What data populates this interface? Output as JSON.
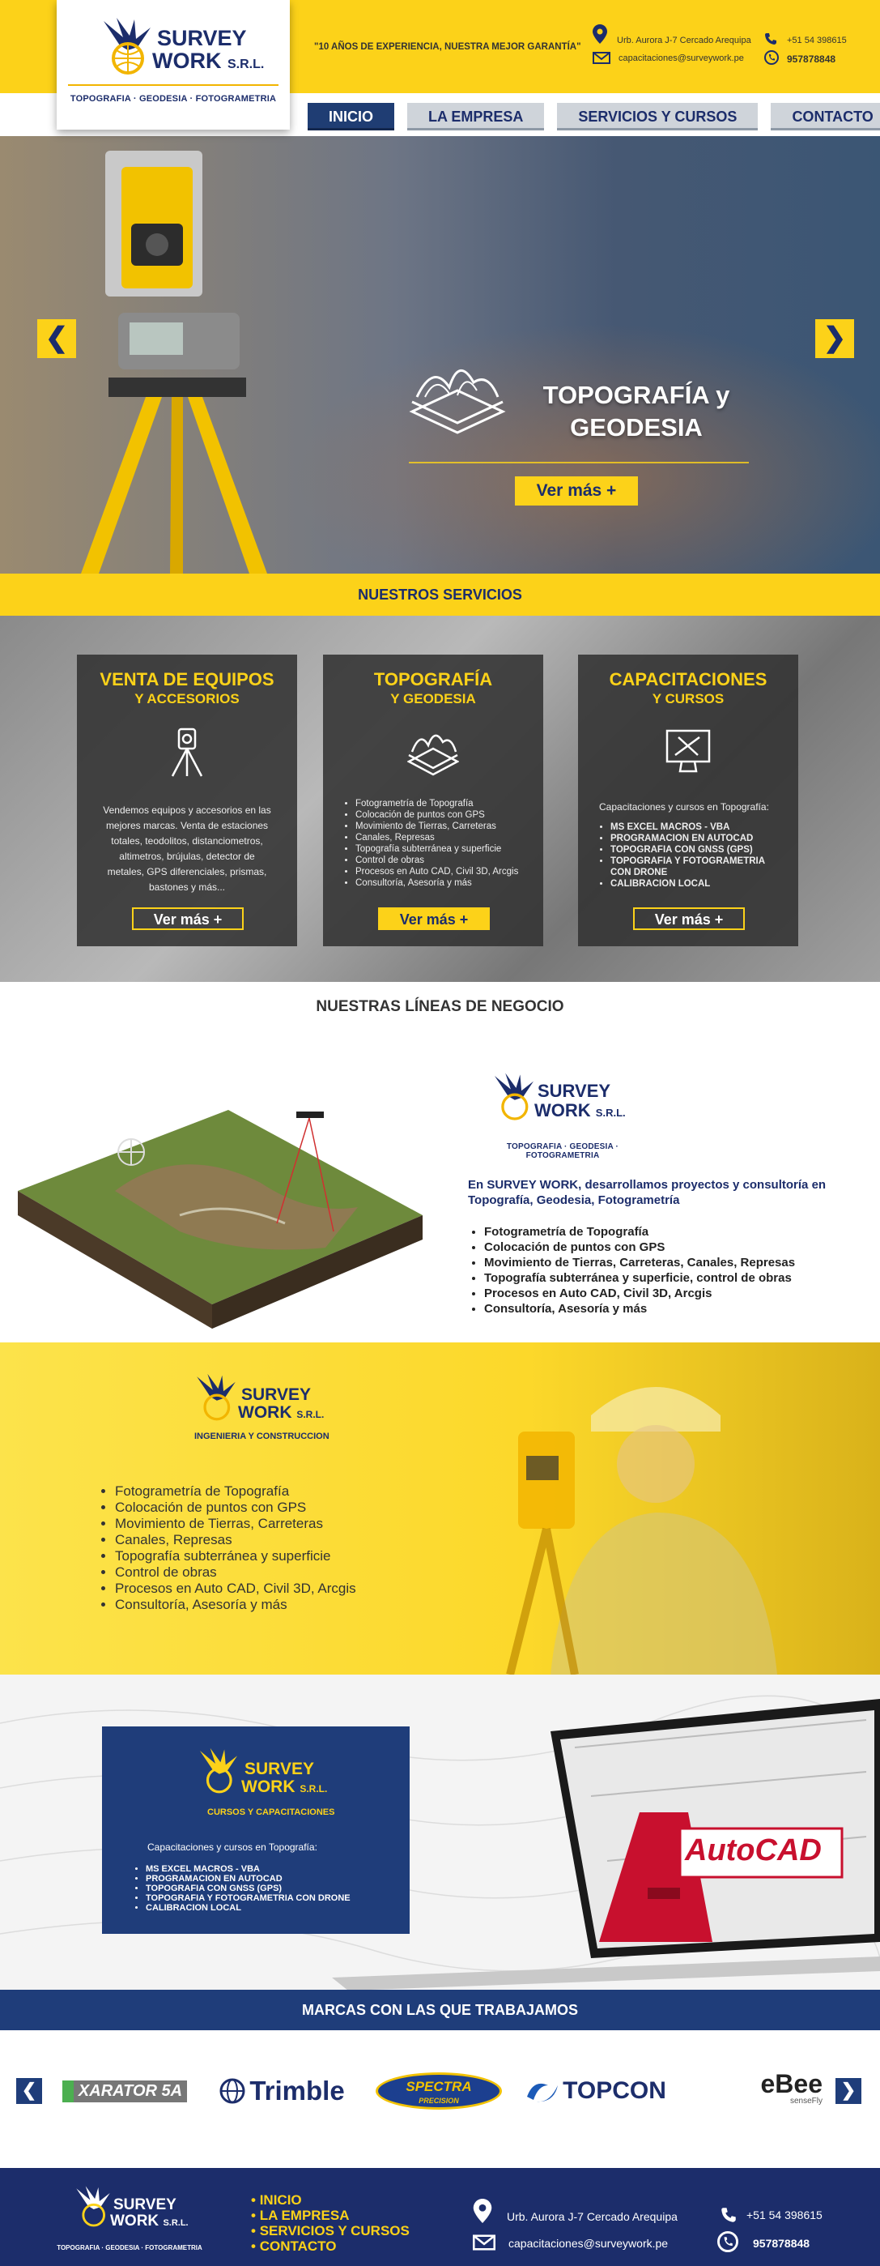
{
  "brand": {
    "name_line1": "SURVEY",
    "name_line2": "WORK",
    "suffix": "S.R.L.",
    "tagline": "TOPOGRAFIA · GEODESIA · FOTOGRAMETRIA",
    "sub_engineering": "INGENIERIA Y CONSTRUCCION",
    "sub_courses": "CURSOS Y CAPACITACIONES"
  },
  "header": {
    "slogan": "\"10 AÑOS DE EXPERIENCIA, NUESTRA MEJOR GARANTÍA\"",
    "address": "Urb. Aurora J-7 Cercado Arequipa",
    "phone": "+51 54 398615",
    "email": "capacitaciones@surveywork.pe",
    "whatsapp": "957878848"
  },
  "nav": {
    "items": [
      {
        "label": "INICIO"
      },
      {
        "label": "LA EMPRESA"
      },
      {
        "label": "SERVICIOS Y CURSOS"
      },
      {
        "label": "CONTACTO"
      }
    ]
  },
  "hero": {
    "title_line1": "TOPOGRAFÍA y",
    "title_line2": "GEODESIA",
    "button": "Ver más +",
    "prev": "❮",
    "next": "❯"
  },
  "services": {
    "heading": "NUESTROS SERVICIOS",
    "cards": [
      {
        "title": "VENTA DE EQUIPOS",
        "subtitle": "Y ACCESORIOS",
        "body": "Vendemos equipos y accesorios en las mejores marcas. Venta de estaciones totales, teodolitos, distanciometros, altimetros, brújulas, detector de metales, GPS diferenciales, prismas, bastones y más...",
        "button": "Ver más +"
      },
      {
        "title": "TOPOGRAFÍA",
        "subtitle": "Y GEODESIA",
        "items": [
          "Fotogrametría de Topografía",
          "Colocación de puntos con GPS",
          "Movimiento de Tierras, Carreteras",
          "Canales, Represas",
          "Topografía subterránea y superficie",
          "Control de obras",
          "Procesos en Auto CAD, Civil 3D, Arcgis",
          "Consultoría, Asesoría y más"
        ],
        "button": "Ver más +"
      },
      {
        "title": "CAPACITACIONES",
        "subtitle": "Y CURSOS",
        "intro": "Capacitaciones y cursos en Topografía:",
        "items": [
          "MS EXCEL MACROS - VBA",
          "PROGRAMACION EN AUTOCAD",
          "TOPOGRAFIA CON GNSS (GPS)",
          "TOPOGRAFIA Y FOTOGRAMETRIA CON DRONE",
          "CALIBRACION LOCAL"
        ],
        "button": "Ver más +"
      }
    ]
  },
  "lines": {
    "heading": "NUESTRAS LÍNEAS DE NEGOCIO",
    "intro": "En SURVEY WORK, desarrollamos proyectos y consultoría en Topografía, Geodesia, Fotogrametría",
    "items": [
      "Fotogrametría de Topografía",
      "Colocación de puntos con GPS",
      "Movimiento de Tierras, Carreteras, Canales, Represas",
      "Topografía subterránea y superficie, control de obras",
      "Procesos en Auto CAD, Civil 3D, Arcgis",
      "Consultoría, Asesoría y más"
    ]
  },
  "engineering": {
    "items": [
      "Fotogrametría de Topografía",
      "Colocación de puntos con GPS",
      "Movimiento de Tierras, Carreteras",
      "Canales, Represas",
      "Topografía subterránea y superficie",
      "Control de obras",
      "Procesos en Auto CAD, Civil 3D, Arcgis",
      "Consultoría, Asesoría y más"
    ]
  },
  "courses": {
    "intro": "Capacitaciones y cursos en Topografía:",
    "items": [
      "MS EXCEL MACROS - VBA",
      "PROGRAMACION EN AUTOCAD",
      "TOPOGRAFIA CON GNSS (GPS)",
      "TOPOGRAFIA Y FOTOGRAMETRIA CON DRONE",
      "CALIBRACION LOCAL"
    ],
    "autocad_label": "AutoCAD"
  },
  "brands": {
    "heading": "MARCAS CON LAS QUE TRABAJAMOS",
    "prev": "❮",
    "next": "❯",
    "items": [
      {
        "label": "XARATOR 5A"
      },
      {
        "label": "Trimble"
      },
      {
        "label": "SPECTRA",
        "sub": "PRECISION"
      },
      {
        "label": "TOPCON"
      },
      {
        "label": "eBee",
        "sub": "senseFly"
      }
    ]
  },
  "footer": {
    "links": [
      "INICIO",
      "LA EMPRESA",
      "SERVICIOS Y CURSOS",
      "CONTACTO"
    ],
    "address": "Urb. Aurora J-7 Cercado Arequipa",
    "phone": "+51 54 398615",
    "email": "capacitaciones@surveywork.pe",
    "whatsapp": "957878848"
  },
  "colors": {
    "yellow": "#fcd219",
    "navy": "#1c2d6b",
    "blue": "#1f3d7a"
  }
}
